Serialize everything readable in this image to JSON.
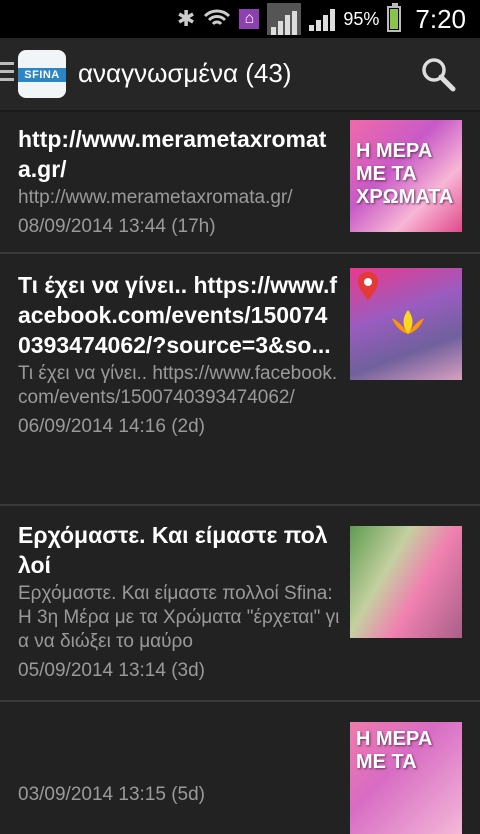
{
  "status_bar": {
    "battery_percent": "95%",
    "time": "7:20"
  },
  "action_bar": {
    "logo_text": "SFINA",
    "title": "αναγνωσμένα (43)"
  },
  "items": [
    {
      "title": "http://www.merametaxromata.gr/",
      "summary": "http://www.merametaxromata.gr/",
      "date": "08/09/2014 13:44 (17h)",
      "thumb_text": "Η ΜΕΡΑ ΜΕ ΤΑ ΧΡΩΜΑΤΑ"
    },
    {
      "title": "Τι έχει να γίνει.. https://www.facebook.com/events/1500740393474062/?source=3&so...",
      "summary": "Τι έχει να γίνει.. https://www.facebook.com/events/1500740393474062/",
      "date": "06/09/2014 14:16 (2d)",
      "thumb_text": ""
    },
    {
      "title": "Ερχόμαστε. Και είμαστε πολλοί",
      "summary": "Ερχόμαστε. Και είμαστε πολλοί Sfina: Η 3η Μέρα με τα Χρώματα \"έρχεται\" για να διώξει το μαύρο",
      "date": "05/09/2014 13:14 (3d)",
      "thumb_text": ""
    },
    {
      "title": "",
      "summary": "",
      "date": "03/09/2014 13:15 (5d)",
      "thumb_text": "Η ΜΕΡΑ ΜΕ ΤΑ"
    }
  ],
  "icons": {
    "menu": "menu-icon",
    "search": "search-icon",
    "bluetooth": "bluetooth-icon",
    "wifi": "wifi-icon",
    "home": "home-icon",
    "signal": "signal-icon",
    "battery": "battery-icon"
  }
}
